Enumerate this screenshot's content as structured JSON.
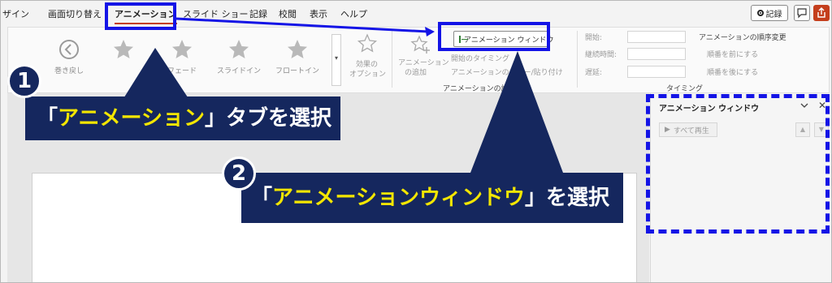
{
  "menu": {
    "tabs": [
      "ザイン",
      "画面切り替え",
      "アニメーション",
      "スライド ショー",
      "記録",
      "校閲",
      "表示",
      "ヘルプ"
    ],
    "active_tab": "アニメーション",
    "record_label": "記録"
  },
  "ribbon": {
    "gallery": [
      {
        "label": "巻き戻し",
        "icon": "rewind-icon"
      },
      {
        "label": "",
        "icon": "star-icon"
      },
      {
        "label": "フェード",
        "icon": "star-icon"
      },
      {
        "label": "スライドイン",
        "icon": "star-icon"
      },
      {
        "label": "フロートイン",
        "icon": "star-icon"
      }
    ],
    "effect_options_l1": "効果の",
    "effect_options_l2": "オプション",
    "add_animation_l1": "アニメーション",
    "add_animation_l2": "の追加",
    "animation_window_label": "アニメーション ウィンドウ",
    "trigger_label": "開始のタイミング",
    "painter_label": "アニメーションのコピー/貼り付け",
    "advanced_group_label": "アニメーションの詳細設定",
    "start_label": "開始:",
    "duration_label": "継続時間:",
    "delay_label": "遅延:",
    "reorder_title": "アニメーションの順序変更",
    "move_earlier": "順番を前にする",
    "move_later": "順番を後にする",
    "timing_group_label": "タイミング"
  },
  "animation_pane": {
    "title": "アニメーション ウィンドウ",
    "play_all": "すべて再生"
  },
  "annotations": {
    "step1_number": "1",
    "step1_text_open": "「",
    "step1_text_emph": "アニメーション",
    "step1_text_close": "」",
    "step1_text_rest": "タブを選択",
    "step2_number": "2",
    "step2_text_open": "「",
    "step2_text_emph": "アニメーションウィンドウ",
    "step2_text_close": "」",
    "step2_text_rest": "を選択",
    "highlight_color": "#1414e6",
    "callout_color": "#15275e",
    "emphasis_color": "#f3e600"
  }
}
